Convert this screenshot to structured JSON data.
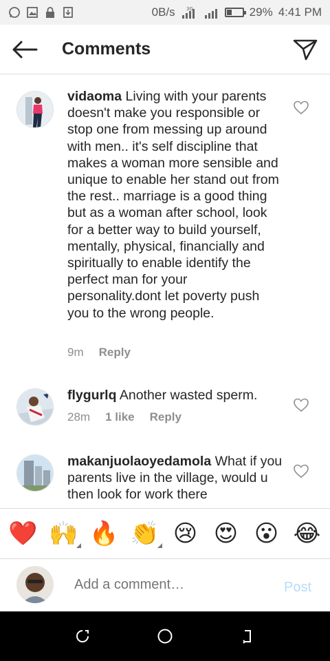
{
  "status_bar": {
    "net_speed": "0B/s",
    "net_type": "3G",
    "battery_text": "29%",
    "battery_level": 0.29,
    "time": "4:41 PM"
  },
  "header": {
    "title": "Comments",
    "back_icon": "arrow-left-icon",
    "send_icon": "paper-plane-icon"
  },
  "comments": [
    {
      "username": "vidaoma",
      "text": "Living with your parents doesn't make you responsible or stop one from messing up around with men.. it's self discipline that makes a woman more sensible and unique to enable her stand out from the rest.. marriage is a good thing but as a woman after school, look for a better way to build yourself, mentally, physical, financially and spiritually to enable identify the perfect man for your personality.dont let poverty push you to the wrong people.",
      "time": "9m",
      "likes": "",
      "reply": "Reply"
    },
    {
      "username": "flygurlq",
      "text": "Another wasted sperm.",
      "time": "28m",
      "likes": "1 like",
      "reply": "Reply"
    },
    {
      "username": "makanjuolaoyedamola",
      "text": "What if you parents live in the village, would u then look for work there",
      "time": "",
      "likes": "",
      "reply": ""
    }
  ],
  "emoji_bar": [
    {
      "glyph": "❤️",
      "name": "heart"
    },
    {
      "glyph": "🙌",
      "name": "raising-hands"
    },
    {
      "glyph": "🔥",
      "name": "fire"
    },
    {
      "glyph": "👏",
      "name": "clapping-hands"
    },
    {
      "glyph": "😢",
      "name": "crying-face"
    },
    {
      "glyph": "😍",
      "name": "heart-eyes"
    },
    {
      "glyph": "😮",
      "name": "surprised-face"
    },
    {
      "glyph": "😂",
      "name": "tears-of-joy"
    }
  ],
  "composer": {
    "placeholder": "Add a comment…",
    "post_label": "Post"
  },
  "colors": {
    "post_disabled": "#b7dcf8",
    "secondary_text": "#8e8e8e"
  }
}
